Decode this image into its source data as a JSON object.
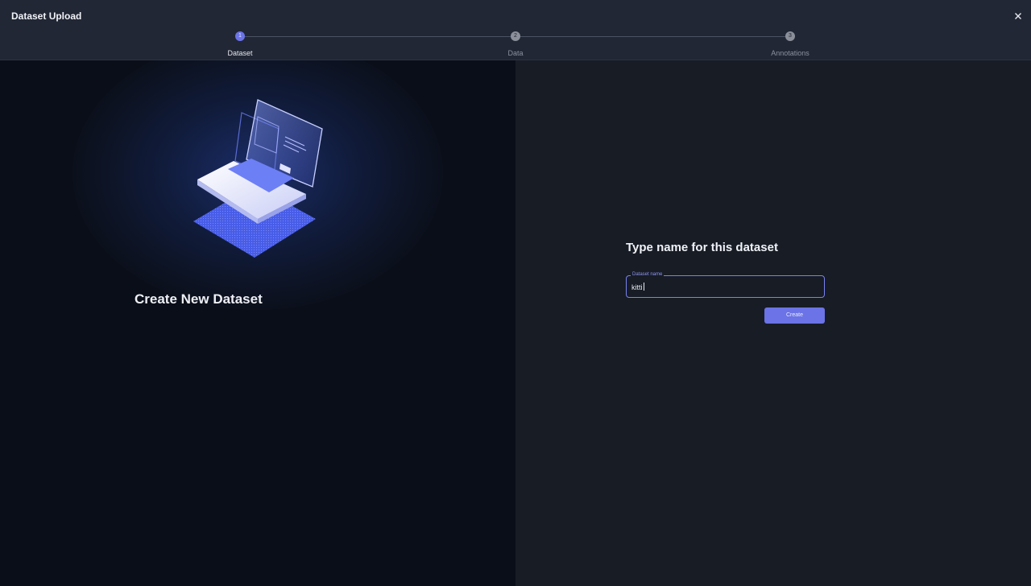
{
  "window": {
    "title": "Dataset Upload"
  },
  "stepper": {
    "steps": [
      {
        "number": "1",
        "label": "Dataset",
        "state": "active"
      },
      {
        "number": "2",
        "label": "Data",
        "state": "inactive"
      },
      {
        "number": "3",
        "label": "Annotations",
        "state": "inactive"
      }
    ]
  },
  "left": {
    "title": "Create New Dataset",
    "illustration": "laptop-illustration"
  },
  "form": {
    "title": "Type name for this dataset",
    "field_label": "Dataset name",
    "field_value": "kitti",
    "create_label": "Create"
  },
  "colors": {
    "accent": "#6b73e6",
    "header_bg": "#212734",
    "left_bg": "#0a0e18",
    "right_bg": "#171c25"
  }
}
